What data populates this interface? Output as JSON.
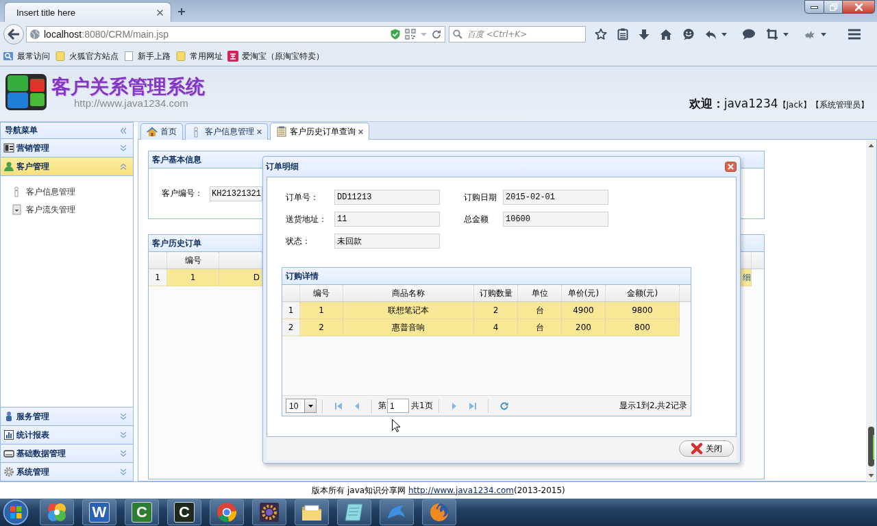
{
  "browser": {
    "tab_title": "Insert title here",
    "url_host": "localhost",
    "url_path": ":8080/CRM/main.jsp",
    "search_placeholder": "百度 <Ctrl+K>",
    "bookmarks": [
      {
        "label": "最常访问",
        "kind": "smart"
      },
      {
        "label": "火狐官方站点",
        "kind": "folder"
      },
      {
        "label": "新手上路",
        "kind": "page"
      },
      {
        "label": "常用网址",
        "kind": "folder"
      },
      {
        "label": "爱淘宝（原淘宝特卖）",
        "kind": "shop"
      }
    ]
  },
  "header": {
    "title": "客户关系管理系统",
    "subtitle": "http://www.java1234.com",
    "welcome": "**欢迎：**java1234",
    "user": "【Jack】",
    "role": "【系统管理员】"
  },
  "nav": {
    "title": "导航菜单",
    "groups": [
      {
        "label": "营销管理",
        "expanded": false
      },
      {
        "label": "客户管理",
        "expanded": true,
        "children": [
          {
            "label": "客户信息管理"
          },
          {
            "label": "客户流失管理"
          }
        ]
      },
      {
        "label": "服务管理",
        "expanded": false
      },
      {
        "label": "统计报表",
        "expanded": false
      },
      {
        "label": "基础数据管理",
        "expanded": false
      },
      {
        "label": "系统管理",
        "expanded": false
      }
    ]
  },
  "tabs": [
    {
      "label": "首页",
      "closable": false,
      "selected": false
    },
    {
      "label": "客户信息管理",
      "closable": true,
      "selected": false
    },
    {
      "label": "客户历史订单查询",
      "closable": true,
      "selected": true
    }
  ],
  "customer_panel": {
    "title": "客户基本信息",
    "fields": [
      {
        "label": "客户编号：",
        "value": "KH21321321"
      }
    ]
  },
  "history_panel": {
    "title": "客户历史订单",
    "columns": [
      "编号"
    ],
    "rows": [
      {
        "number": "1",
        "cells": [
          "1",
          "D"
        ],
        "action": "细",
        "selected": true
      }
    ]
  },
  "dialog": {
    "title": "订单明细",
    "fields": [
      {
        "label": "订单号：",
        "value": "DD11213"
      },
      {
        "label": "订购日期",
        "value": "2015-02-01"
      },
      {
        "label": "送货地址：",
        "value": "11"
      },
      {
        "label": "总金额",
        "value": "10600"
      },
      {
        "label": "状态：",
        "value": "未回款"
      }
    ],
    "detail": {
      "title": "订购详情",
      "columns": [
        "编号",
        "商品名称",
        "订购数量",
        "单位",
        "单价(元)",
        "金额(元)"
      ],
      "rows": [
        {
          "number": "1",
          "cells": [
            "1",
            "联想笔记本",
            "2",
            "台",
            "4900",
            "9800"
          ],
          "selected": true
        },
        {
          "number": "2",
          "cells": [
            "2",
            "惠普音响",
            "4",
            "台",
            "200",
            "800"
          ],
          "selected": true
        }
      ],
      "pager": {
        "page_size": "10",
        "page_label": "第",
        "page": "1",
        "total_pages": "共1页",
        "summary": "显示1到2,共2记录"
      }
    },
    "buttons": [
      {
        "label": "关闭"
      }
    ]
  },
  "footer": {
    "text": "版本所有 java知识分享网 ",
    "link": "http://www.java1234.com",
    "suffix": "(2013-2015)"
  },
  "taskbar": [
    {
      "kind": "pinwheel"
    },
    {
      "kind": "letter",
      "label": "W",
      "color": "#2a62b8"
    },
    {
      "kind": "letter",
      "label": "C",
      "color": "#2f7d32"
    },
    {
      "kind": "letter",
      "label": "C",
      "color": "#1d2b1d"
    },
    {
      "kind": "chrome"
    },
    {
      "kind": "ide"
    },
    {
      "kind": "folder"
    },
    {
      "kind": "notepad"
    },
    {
      "kind": "dolphin"
    },
    {
      "kind": "firefox"
    }
  ]
}
